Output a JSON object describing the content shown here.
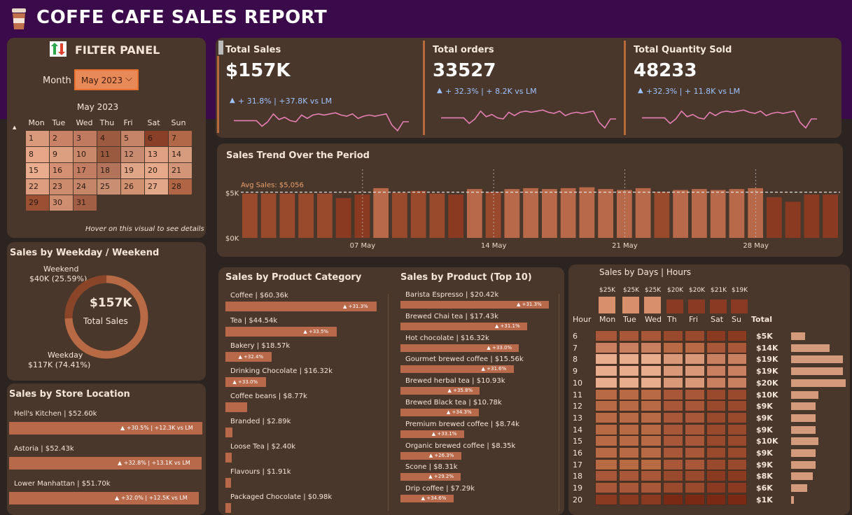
{
  "header": {
    "title": "COFFE CAFE SALES REPORT",
    "icon": "coffee-cup-icon"
  },
  "filter": {
    "title": "FILTER PANEL",
    "month_label": "Month",
    "month_value": "May 2023",
    "cal_title": "May 2023",
    "days": [
      "Mon",
      "Tue",
      "Wed",
      "Thu",
      "Fri",
      "Sat",
      "Sun"
    ],
    "hint": "Hover on this visual to see details",
    "weeks": [
      [
        "1",
        "2",
        "3",
        "4",
        "5",
        "6",
        "7"
      ],
      [
        "8",
        "9",
        "10",
        "11",
        "12",
        "13",
        "14"
      ],
      [
        "15",
        "16",
        "17",
        "18",
        "19",
        "20",
        "21"
      ],
      [
        "22",
        "23",
        "24",
        "25",
        "26",
        "27",
        "28"
      ],
      [
        "29",
        "30",
        "31",
        "",
        "",
        "",
        ""
      ]
    ],
    "shades": [
      [
        "#d99a7c",
        "#c98265",
        "#c07a60",
        "#9c5a40",
        "#c58468",
        "#8a4028",
        "#b06848"
      ],
      [
        "#e8a688",
        "#dca080",
        "#c98869",
        "#9a5a40",
        "#c88b70",
        "#e0a083",
        "#d79b7d"
      ],
      [
        "#e9ad8d",
        "#d58f72",
        "#c27c62",
        "#b2735a",
        "#e0a586",
        "#e6aa8b",
        "#d39578"
      ],
      [
        "#df9d80",
        "#cd8b6e",
        "#c58568",
        "#c98f73",
        "#cf916f",
        "#e2a688",
        "#b06644"
      ],
      [
        "#9b4f33",
        "#d08e70",
        "#a35f45",
        "",
        "",
        "",
        ""
      ]
    ]
  },
  "kpis": [
    {
      "title": "Total Sales",
      "value": "$157K",
      "delta": "+ 31.8% | +37.8K vs LM"
    },
    {
      "title": "Total orders",
      "value": "33527",
      "delta": "+ 32.3% | + 8.2K vs LM"
    },
    {
      "title": "Total Quantity Sold",
      "value": "48233",
      "delta": "+32.3% | + 11.8K vs LM"
    }
  ],
  "trend": {
    "title": "Sales Trend Over the Period",
    "avg_label": "Avg Sales: $5,056",
    "y_labels": [
      "$5K",
      "$0K"
    ],
    "x_labels": [
      "07 May",
      "14 May",
      "21 May",
      "28 May"
    ]
  },
  "chart_data": {
    "type": "bar",
    "title": "Sales Trend Over the Period",
    "x": [
      "1",
      "2",
      "3",
      "4",
      "5",
      "6",
      "7",
      "8",
      "9",
      "10",
      "11",
      "12",
      "13",
      "14",
      "15",
      "16",
      "17",
      "18",
      "19",
      "20",
      "21",
      "22",
      "23",
      "24",
      "25",
      "26",
      "27",
      "28",
      "29",
      "30",
      "31"
    ],
    "values": [
      4.9,
      4.9,
      4.9,
      4.9,
      4.9,
      4.4,
      4.8,
      5.5,
      5.0,
      5.2,
      4.9,
      4.8,
      5.4,
      5.1,
      5.4,
      5.5,
      5.4,
      5.5,
      5.6,
      5.4,
      5.3,
      5.5,
      5.1,
      5.3,
      5.4,
      5.3,
      5.4,
      5.5,
      4.5,
      4.0,
      4.8,
      4.8
    ],
    "avg": 5.056,
    "ylim": [
      0,
      6
    ]
  },
  "weekday": {
    "title": "Sales by Weekday / Weekend",
    "center_value": "$157K",
    "center_label": "Total Sales",
    "weekend_label": "Weekend",
    "weekend_value": "$40K (25.59%)",
    "weekday_label": "Weekday",
    "weekday_value": "$117K (74.41%)",
    "weekend_pct": 25.59
  },
  "stores": {
    "title": "Sales by Store Location",
    "items": [
      {
        "label": "Hell's Kitchen | $52.60k",
        "delta": "▲ +30.5% | +12.3K vs LM",
        "pct": 100
      },
      {
        "label": "Astoria | $52.43k",
        "delta": "▲ +32.8% | +13.1K vs LM",
        "pct": 99.7
      },
      {
        "label": "Lower Manhattan | $51.70k",
        "delta": "▲ +32.0% | +12.5K vs LM",
        "pct": 98.3
      }
    ]
  },
  "category": {
    "title": "Sales by Product Category",
    "items": [
      {
        "label": "Coffee | $60.36k",
        "delta": "▲ +31.3%",
        "v": 60.36
      },
      {
        "label": "Tea | $44.54k",
        "delta": "▲ +33.5%",
        "v": 44.54
      },
      {
        "label": "Bakery | $18.57k",
        "delta": "▲ +32.4%",
        "v": 18.57
      },
      {
        "label": "Drinking Chocolate | $16.32k",
        "delta": "▲ +33.0%",
        "v": 16.32
      },
      {
        "label": "Coffee beans | $8.77k",
        "delta": "",
        "v": 8.77
      },
      {
        "label": "Branded | $2.89k",
        "delta": "",
        "v": 2.89
      },
      {
        "label": "Loose Tea | $2.40k",
        "delta": "",
        "v": 2.4
      },
      {
        "label": "Flavours | $1.91k",
        "delta": "",
        "v": 1.91
      },
      {
        "label": "Packaged Chocolate | $0.98k",
        "delta": "",
        "v": 0.98
      }
    ]
  },
  "products": {
    "title": "Sales by Product (Top 10)",
    "items": [
      {
        "label": "Barista Espresso | $20.42k",
        "delta": "▲ +31.3%",
        "v": 20.42
      },
      {
        "label": "Brewed Chai tea | $17.43k",
        "delta": "▲ +31.1%",
        "v": 17.43
      },
      {
        "label": "Hot chocolate | $16.32k",
        "delta": "▲ +33.0%",
        "v": 16.32
      },
      {
        "label": "Gourmet brewed coffee | $15.56k",
        "delta": "▲ +31.6%",
        "v": 15.56
      },
      {
        "label": "Brewed herbal tea | $10.93k",
        "delta": "▲ +35.8%",
        "v": 10.93
      },
      {
        "label": "Brewed Black tea | $10.78k",
        "delta": "▲ +34.3%",
        "v": 10.78
      },
      {
        "label": "Premium brewed coffee | $8.74k",
        "delta": "▲ +33.1%",
        "v": 8.74
      },
      {
        "label": "Organic brewed coffee | $8.35k",
        "delta": "▲ +26.3%",
        "v": 8.35
      },
      {
        "label": "Scone | $8.31k",
        "delta": "▲ +29.2%",
        "v": 8.31
      },
      {
        "label": "Drip coffee | $7.29k",
        "delta": "▲ +34.6%",
        "v": 7.29
      }
    ]
  },
  "heatmap": {
    "title": "Sales by Days | Hours",
    "hour_label": "Hour",
    "total_label": "Total",
    "days": [
      "Mon",
      "Tue",
      "Wed",
      "Th",
      "Fri",
      "Sat",
      "Su"
    ],
    "day_totals": [
      "$25K",
      "$25K",
      "$25K",
      "$20K",
      "$20K",
      "$21K",
      "$19K"
    ],
    "hours": [
      "6",
      "7",
      "8",
      "9",
      "10",
      "11",
      "12",
      "13",
      "14",
      "15",
      "16",
      "17",
      "18",
      "19",
      "20"
    ],
    "hour_totals": [
      "$5K",
      "$14K",
      "$19K",
      "$19K",
      "$20K",
      "$10K",
      "$9K",
      "$9K",
      "$9K",
      "$10K",
      "$9K",
      "$9K",
      "$8K",
      "$6K",
      "$1K"
    ],
    "hour_values": [
      5,
      14,
      19,
      19,
      20,
      10,
      9,
      9,
      9,
      10,
      9,
      9,
      8,
      6,
      1
    ]
  }
}
